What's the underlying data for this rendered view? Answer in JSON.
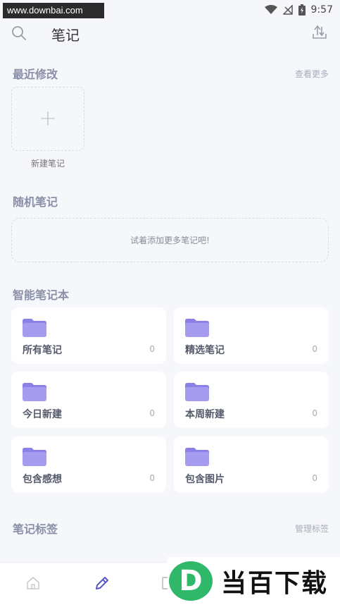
{
  "watermark_top": "www.downbai.com",
  "status_bar": {
    "time": "9:57"
  },
  "header": {
    "title": "笔记",
    "search_icon": "search-icon",
    "upload_icon": "upload-icon"
  },
  "recent": {
    "title": "最近修改",
    "more_label": "查看更多",
    "new_note_label": "新建笔记"
  },
  "random": {
    "title": "随机笔记",
    "empty_text": "试着添加更多笔记吧!"
  },
  "smart": {
    "title": "智能笔记本",
    "cards": [
      {
        "label": "所有笔记",
        "count": "0"
      },
      {
        "label": "精选笔记",
        "count": "0"
      },
      {
        "label": "今日新建",
        "count": "0"
      },
      {
        "label": "本周新建",
        "count": "0"
      },
      {
        "label": "包含感想",
        "count": "0"
      },
      {
        "label": "包含图片",
        "count": "0"
      }
    ]
  },
  "tags": {
    "title": "笔记标签",
    "manage_label": "管理标签"
  },
  "watermark_logo": {
    "letter": "D",
    "text": "当百下载"
  },
  "colors": {
    "folder": "#a59cf0",
    "folder_tab": "#8b80e6",
    "accent_nav": "#5b55c9"
  }
}
